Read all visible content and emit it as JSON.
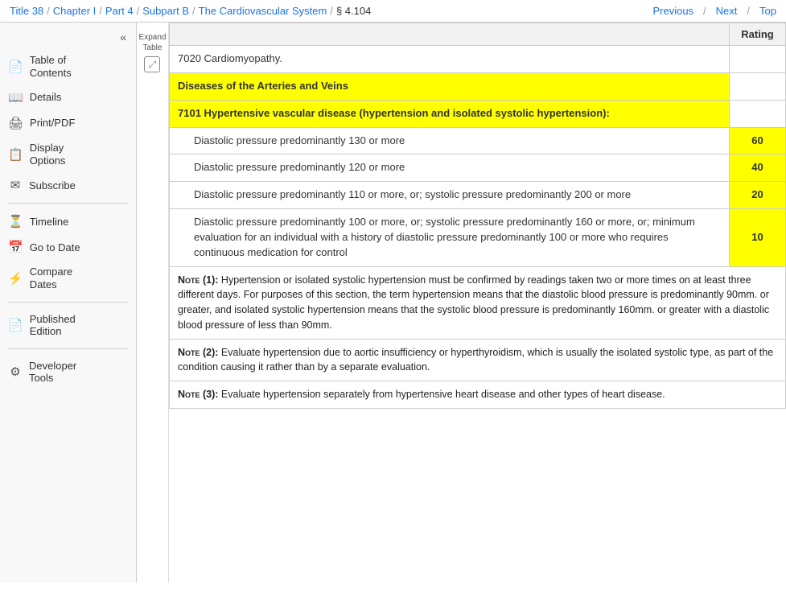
{
  "header": {
    "breadcrumbs": [
      {
        "label": "Title 38",
        "href": "#"
      },
      {
        "label": "Chapter I",
        "href": "#"
      },
      {
        "label": "Part 4",
        "href": "#"
      },
      {
        "label": "Subpart B",
        "href": "#"
      },
      {
        "label": "The Cardiovascular System",
        "href": "#"
      },
      {
        "label": "§ 4.104",
        "href": null
      }
    ],
    "nav_links": [
      {
        "label": "Previous",
        "href": "#"
      },
      {
        "label": "Next",
        "href": "#"
      },
      {
        "label": "Top",
        "href": "#"
      }
    ]
  },
  "sidebar": {
    "collapse_label": "«",
    "expand_table_label": "Expand\nTable",
    "items": [
      {
        "id": "toc",
        "label": "Table of Contents",
        "icon": "📄"
      },
      {
        "id": "details",
        "label": "Details",
        "icon": "📖"
      },
      {
        "id": "print",
        "label": "Print/PDF",
        "icon": "🖨"
      },
      {
        "id": "display",
        "label": "Display Options",
        "icon": "📋"
      },
      {
        "id": "subscribe",
        "label": "Subscribe",
        "icon": "✉"
      },
      {
        "id": "timeline",
        "label": "Timeline",
        "icon": "⏳"
      },
      {
        "id": "gotodate",
        "label": "Go to Date",
        "icon": "📅"
      },
      {
        "id": "compare",
        "label": "Compare Dates",
        "icon": "⚡"
      },
      {
        "id": "published",
        "label": "Published Edition",
        "icon": "📄"
      },
      {
        "id": "devtools",
        "label": "Developer Tools",
        "icon": "⚙"
      }
    ]
  },
  "table": {
    "col_rating": "Rating",
    "rows": [
      {
        "type": "plain",
        "text": "7020 Cardiomyopathy.",
        "rating": "",
        "highlight": false,
        "indented": false
      },
      {
        "type": "section_header",
        "text": "Diseases of the Arteries and Veins",
        "highlight": true,
        "indented": false,
        "rating": ""
      },
      {
        "type": "plain",
        "text": "7101 Hypertensive vascular disease (hypertension and isolated systolic hypertension):",
        "highlight": true,
        "indented": false,
        "rating": ""
      },
      {
        "type": "indented",
        "text": "Diastolic pressure predominantly 130 or more",
        "rating": "60",
        "highlight": false,
        "indented": true
      },
      {
        "type": "indented",
        "text": "Diastolic pressure predominantly 120 or more",
        "rating": "40",
        "highlight": false,
        "indented": true
      },
      {
        "type": "indented",
        "text": "Diastolic pressure predominantly 110 or more, or; systolic pressure predominantly 200 or more",
        "rating": "20",
        "highlight": false,
        "indented": true
      },
      {
        "type": "indented",
        "text": "Diastolic pressure predominantly 100 or more, or; systolic pressure predominantly 160 or more, or; minimum evaluation for an individual with a history of diastolic pressure predominantly 100 or more who requires continuous medication for control",
        "rating": "10",
        "highlight": false,
        "indented": true
      },
      {
        "type": "note",
        "note_num": "(1)",
        "text": "Hypertension or isolated systolic hypertension must be confirmed by readings taken two or more times on at least three different days. For purposes of this section, the term hypertension means that the diastolic blood pressure is predominantly 90mm. or greater, and isolated systolic hypertension means that the systolic blood pressure is predominantly 160mm. or greater with a diastolic blood pressure of less than 90mm.",
        "rating": ""
      },
      {
        "type": "note",
        "note_num": "(2)",
        "text": "Evaluate hypertension due to aortic insufficiency or hyperthyroidism, which is usually the isolated systolic type, as part of the condition causing it rather than by a separate evaluation.",
        "rating": ""
      },
      {
        "type": "note",
        "note_num": "(3)",
        "text": "Evaluate hypertension separately from hypertensive heart disease and other types of heart disease.",
        "rating": ""
      }
    ]
  }
}
